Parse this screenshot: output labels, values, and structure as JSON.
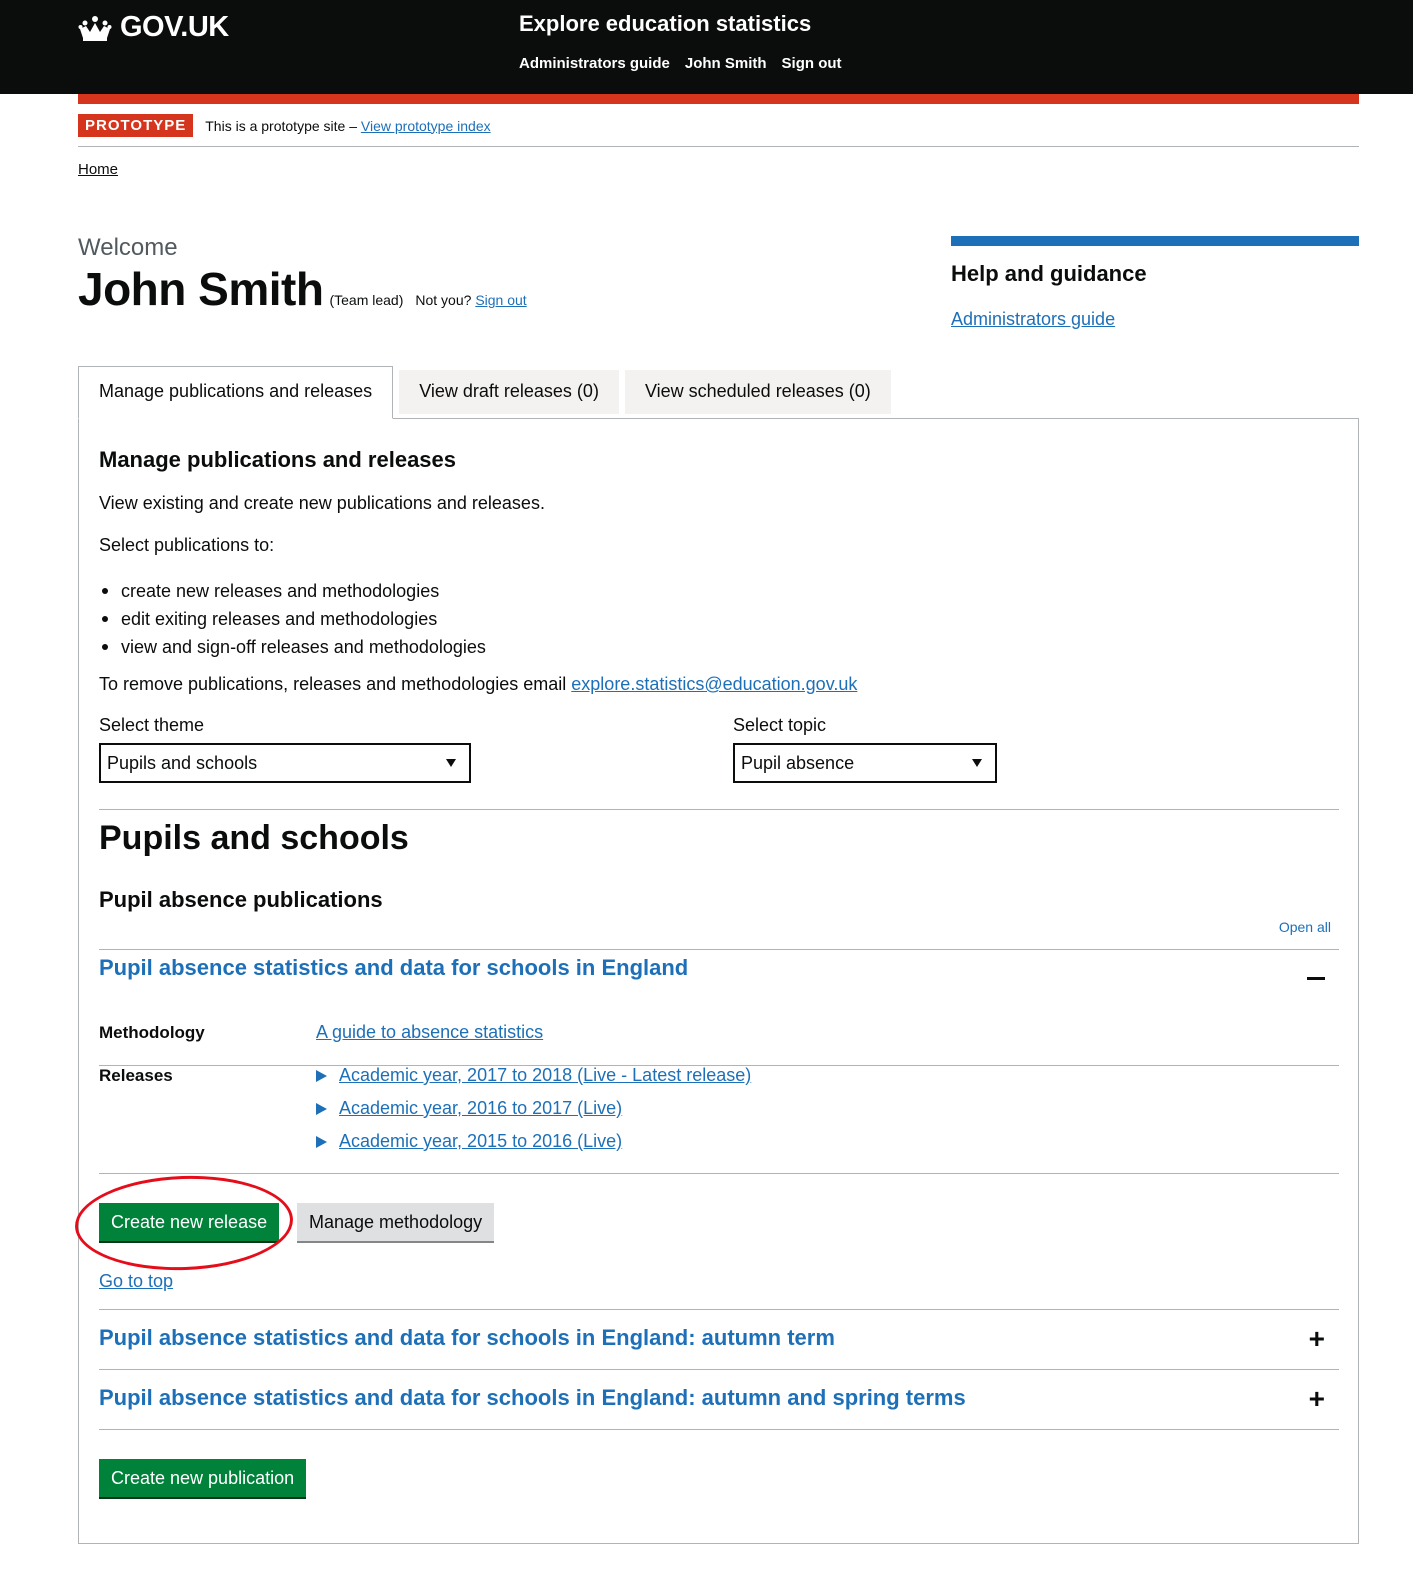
{
  "header": {
    "logo_text": "GOV.UK",
    "service_name": "Explore education statistics",
    "nav": [
      "Administrators guide",
      "John Smith",
      "Sign out"
    ]
  },
  "phase": {
    "tag": "PROTOTYPE",
    "text": "This is a prototype site –",
    "link": "View prototype index"
  },
  "breadcrumb": {
    "home": "Home"
  },
  "user": {
    "welcome": "Welcome",
    "name": "John Smith",
    "role": "(Team lead)",
    "not_you": "Not you?",
    "sign_out": "Sign out"
  },
  "help": {
    "title": "Help and guidance",
    "link": "Administrators guide"
  },
  "tabs": [
    {
      "label": "Manage publications and releases",
      "active": true
    },
    {
      "label": "View draft releases (0)",
      "active": false
    },
    {
      "label": "View scheduled releases (0)",
      "active": false
    }
  ],
  "manage": {
    "heading": "Manage publications and releases",
    "intro": "View existing and create new publications and releases.",
    "select_intro": "Select publications to:",
    "bullets": [
      "create new releases and methodologies",
      "edit exiting releases and methodologies",
      "view and sign-off releases and methodologies"
    ],
    "remove_text": "To remove publications, releases and methodologies email",
    "email": "explore.statistics@education.gov.uk"
  },
  "filters": {
    "theme_label": "Select theme",
    "theme_value": "Pupils and schools",
    "topic_label": "Select topic",
    "topic_value": "Pupil absence"
  },
  "theme_heading": "Pupils and schools",
  "topic_heading": "Pupil absence publications",
  "open_all": "Open all",
  "publications": [
    {
      "title": "Pupil absence statistics and data for schools in England",
      "expanded": true,
      "methodology_label": "Methodology",
      "methodology_link": "A guide to absence statistics",
      "releases_label": "Releases",
      "releases": [
        "Academic year, 2017 to 2018 (Live - Latest release)",
        "Academic year, 2016 to 2017 (Live)",
        "Academic year, 2015 to 2016 (Live)"
      ],
      "create_release": "Create new release",
      "manage_methodology": "Manage methodology",
      "go_to_top": "Go to top"
    },
    {
      "title": "Pupil absence statistics and data for schools in England: autumn term",
      "expanded": false
    },
    {
      "title": "Pupil absence statistics and data for schools in England: autumn and spring terms",
      "expanded": false
    }
  ],
  "create_publication": "Create new publication",
  "colors": {
    "header_bg": "#0b0c0c",
    "accent_red": "#d4351c",
    "link_blue": "#1d70b8",
    "button_green": "#00823b",
    "highlight_ring": "#e50d1a"
  }
}
